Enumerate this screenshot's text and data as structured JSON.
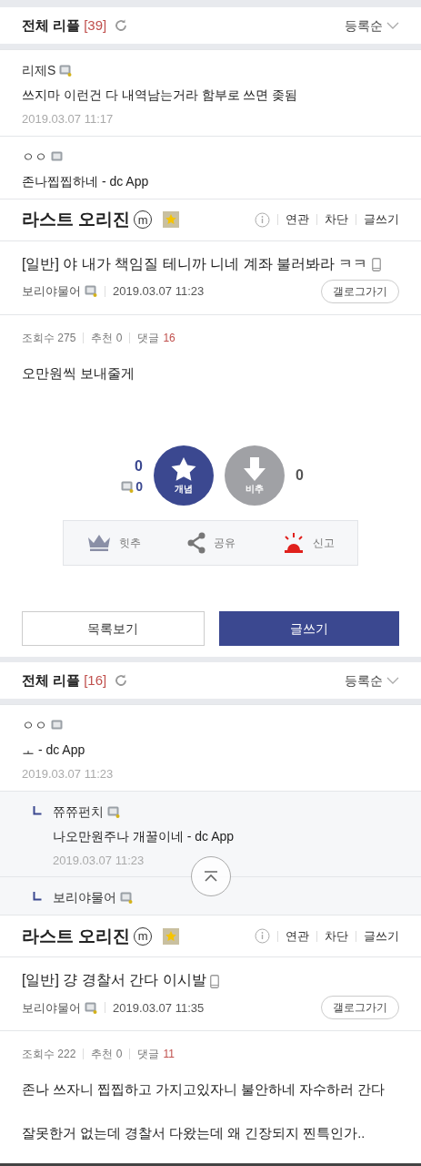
{
  "sections": [
    {
      "comments_header": {
        "title": "전체 리플",
        "count": "[39]",
        "sort": "등록순"
      },
      "comments": [
        {
          "author": "리제S",
          "kind": "fixed",
          "body": "쓰지마 이런건 다 내역남는거라 함부로 쓰면 좆됨",
          "time": "2019.03.07 11:17"
        },
        {
          "author": "ㅇㅇ",
          "kind": "guest",
          "body": "존나찝찝하네 - dc App"
        }
      ],
      "gallery_bar": {
        "name": "라스트 오리진",
        "badge": "m",
        "actions": [
          "연관",
          "차단",
          "글쓰기"
        ]
      },
      "post": {
        "title": "[일반] 야 내가 책임질 테니까 니네 계좌 불러봐라 ㅋㅋ",
        "author": "보리야물어",
        "date": "2019.03.07 11:23",
        "gallog_button": "갤로그가기",
        "views": "조회수 275",
        "recommend": "추천 0",
        "comments_label": "댓글",
        "comments_count": "16",
        "body": [
          "오만원씩 보내줄게"
        ]
      },
      "votes": {
        "up_count": "0",
        "fixed_up_count": "0",
        "up_label": "개념",
        "down_label": "비추",
        "down_count": "0"
      },
      "share_bar": [
        {
          "kind": "crown",
          "label": "힛추"
        },
        {
          "kind": "share",
          "label": "공유"
        },
        {
          "kind": "siren",
          "label": "신고"
        }
      ],
      "buttons": [
        {
          "label": "목록보기",
          "primary": false
        },
        {
          "label": "글쓰기",
          "primary": true
        }
      ]
    },
    {
      "comments_header": {
        "title": "전체 리플",
        "count": "[16]",
        "sort": "등록순"
      },
      "comments": [
        {
          "author": "ㅇㅇ",
          "kind": "guest",
          "body": "ㅗ - dc App",
          "time": "2019.03.07 11:23",
          "children": [
            {
              "author": "쮸쮸펀치",
              "kind": "fixed",
              "body": "나오만원주나 개꿀이네 - dc App",
              "time": "2019.03.07 11:23"
            },
            {
              "author": "보리야물어",
              "kind": "fixed"
            }
          ]
        }
      ],
      "gallery_bar": {
        "name": "라스트 오리진",
        "badge": "m",
        "actions": [
          "연관",
          "차단",
          "글쓰기"
        ]
      },
      "post": {
        "title": "[일반] 걍 경찰서 간다 이시발",
        "author": "보리야물어",
        "date": "2019.03.07 11:35",
        "gallog_button": "갤로그가기",
        "views": "조회수 222",
        "recommend": "추천 0",
        "comments_label": "댓글",
        "comments_count": "11",
        "body": [
          "존나 쓰자니 찝찝하고 가지고있자니 불안하네 자수하러 간다",
          "잘못한거 없는데 경찰서 다왔는데 왜 긴장되지 찐특인가.."
        ]
      }
    }
  ]
}
